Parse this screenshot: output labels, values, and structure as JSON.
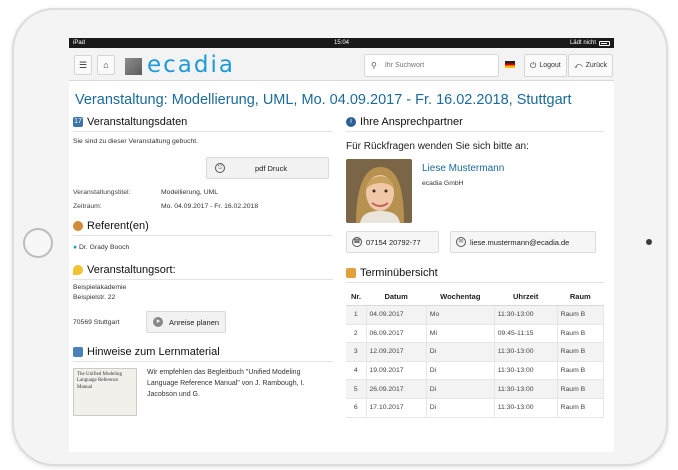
{
  "status_bar": {
    "left": "iPad",
    "time": "15:04",
    "right": "Lädt nicht"
  },
  "nav": {
    "brand": "ecadia",
    "search_placeholder": "Ihr Suchwort",
    "logout_label": "Logout",
    "back_label": "Zurück"
  },
  "page_title": "Veranstaltung: Modellierung, UML, Mo. 04.09.2017 - Fr. 16.02.2018, Stuttgart",
  "event": {
    "heading": "Veranstaltungsdaten",
    "booked_note": "Sie sind zu dieser Veranstaltung gebucht.",
    "pdf_label": "pdf Druck",
    "fields": [
      {
        "key": "Veranstaltungstitel:",
        "value": "Modellierung, UML"
      },
      {
        "key": "Zeitraum:",
        "value": "Mo. 04.09.2017 - Fr. 16.02.2018"
      }
    ]
  },
  "speakers": {
    "heading": "Referent(en)",
    "items": [
      "Dr. Grady Booch"
    ]
  },
  "venue": {
    "heading": "Veranstaltungsort:",
    "name": "Beispielakademie",
    "street": "Beispielstr. 22",
    "city": "70569 Stuttgart",
    "route_label": "Anreise planen"
  },
  "material": {
    "heading": "Hinweise zum Lernmaterial",
    "text": "Wir empfehlen das Begleitbuch \"Unified Modeling Language Reference Manual\" von J. Rambough, I. Jacobson und G.",
    "book_cover": "The Unified Modeling Language Reference Manual"
  },
  "contact": {
    "heading": "Ihre Ansprechpartner",
    "subheading": "Für Rückfragen wenden Sie sich bitte an:",
    "name": "Liese Mustermann",
    "company": "ecadia GmbH",
    "phone": "07154 20792-77",
    "email": "liese.mustermann@ecadia.de"
  },
  "schedule": {
    "heading": "Terminübersicht",
    "columns": [
      "Nr.",
      "Datum",
      "Wochentag",
      "Uhrzeit",
      "Raum"
    ],
    "rows": [
      [
        "1",
        "04.09.2017",
        "Mo",
        "11:30-13:00",
        "Raum B"
      ],
      [
        "2",
        "06.09.2017",
        "Mi",
        "09:45-11:15",
        "Raum B"
      ],
      [
        "3",
        "12.09.2017",
        "Di",
        "11:30-13:00",
        "Raum B"
      ],
      [
        "4",
        "19.09.2017",
        "Di",
        "11:30-13:00",
        "Raum B"
      ],
      [
        "5",
        "26.09.2017",
        "Di",
        "11:30-13:00",
        "Raum B"
      ],
      [
        "6",
        "17.10.2017",
        "Di",
        "11:30-13:00",
        "Raum B"
      ]
    ]
  },
  "colors": {
    "brand": "#1d9bd7",
    "title": "#1a6a9a",
    "status_bar": "#1a1a1a"
  },
  "icons": [
    "home-icon",
    "menu-icon",
    "search-icon",
    "flag-de-icon",
    "power-icon",
    "back-arrow-icon",
    "calendar-icon",
    "person-icon",
    "pin-icon",
    "book-icon",
    "info-icon",
    "phone-icon",
    "email-icon",
    "printer-icon",
    "route-icon",
    "schedule-icon"
  ]
}
